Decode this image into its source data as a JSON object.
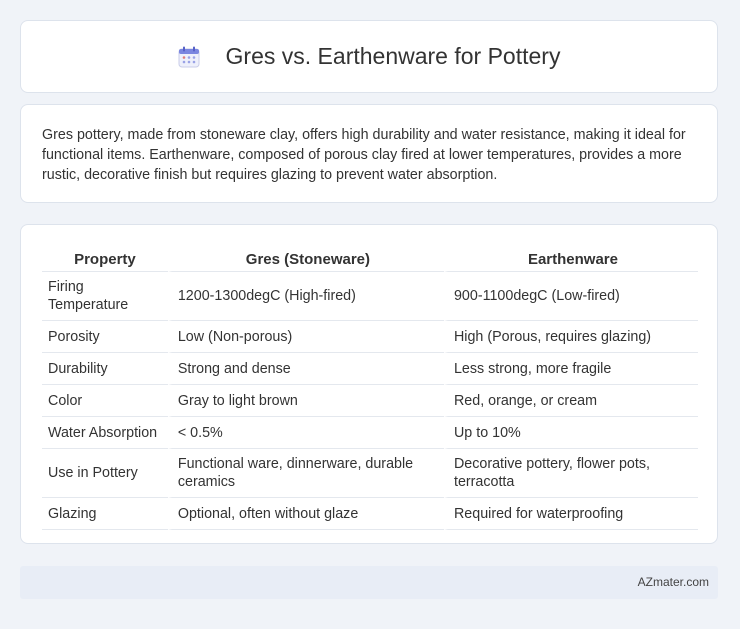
{
  "header": {
    "icon": "calendar-icon",
    "title": "Gres vs. Earthenware for Pottery"
  },
  "intro": {
    "text": "Gres pottery, made from stoneware clay, offers high durability and water resistance, making it ideal for functional items. Earthenware, composed of porous clay fired at lower temperatures, provides a more rustic, decorative finish but requires glazing to prevent water absorption."
  },
  "table": {
    "headers": [
      "Property",
      "Gres (Stoneware)",
      "Earthenware"
    ],
    "rows": [
      [
        "Firing Temperature",
        "1200-1300degC (High-fired)",
        "900-1100degC (Low-fired)"
      ],
      [
        "Porosity",
        "Low (Non-porous)",
        "High (Porous, requires glazing)"
      ],
      [
        "Durability",
        "Strong and dense",
        "Less strong, more fragile"
      ],
      [
        "Color",
        "Gray to light brown",
        "Red, orange, or cream"
      ],
      [
        "Water Absorption",
        "< 0.5%",
        "Up to 10%"
      ],
      [
        "Use in Pottery",
        "Functional ware, dinnerware, durable ceramics",
        "Decorative pottery, flower pots, terracotta"
      ],
      [
        "Glazing",
        "Optional, often without glaze",
        "Required for waterproofing"
      ]
    ]
  },
  "footer": {
    "text": "AZmater.com"
  }
}
